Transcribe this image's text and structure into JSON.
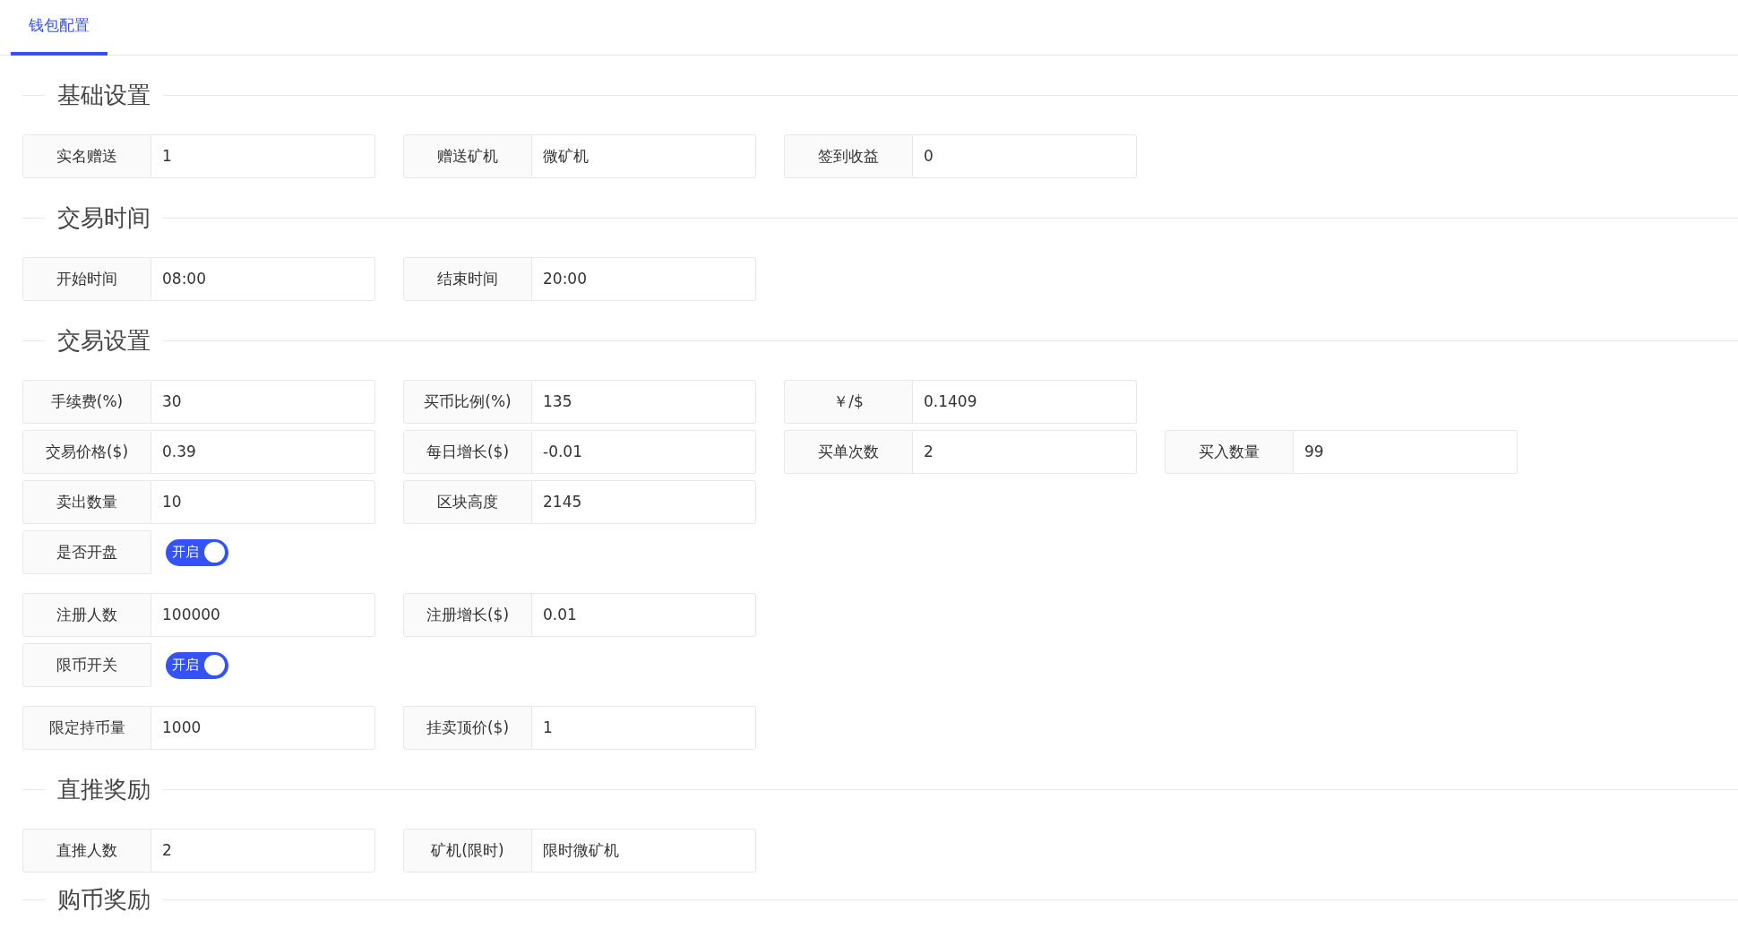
{
  "tabs": [
    {
      "label": "钱包配置",
      "selected": true
    }
  ],
  "sections": [
    {
      "title": "基础设置",
      "rows": [
        [
          {
            "kind": "input",
            "label": "实名赠送",
            "value": "1"
          },
          {
            "kind": "input",
            "label": "赠送矿机",
            "value": "微矿机"
          },
          {
            "kind": "input",
            "label": "签到收益",
            "value": "0"
          }
        ]
      ]
    },
    {
      "title": "交易时间",
      "rows": [
        [
          {
            "kind": "input",
            "label": "开始时间",
            "value": "08:00"
          },
          {
            "kind": "input",
            "label": "结束时间",
            "value": "20:00"
          }
        ]
      ]
    },
    {
      "title": "交易设置",
      "rows": [
        [
          {
            "kind": "input",
            "label": "手续费(%)",
            "value": "30"
          },
          {
            "kind": "input",
            "label": "买币比例(%)",
            "value": "135"
          },
          {
            "kind": "input",
            "label": "￥/$",
            "value": "0.1409"
          }
        ],
        [
          {
            "kind": "input",
            "label": "交易价格($)",
            "value": "0.39"
          },
          {
            "kind": "input",
            "label": "每日增长($)",
            "value": "-0.01"
          },
          {
            "kind": "input",
            "label": "买单次数",
            "value": "2"
          },
          {
            "kind": "input",
            "label": "买入数量",
            "value": "99"
          }
        ],
        [
          {
            "kind": "input",
            "label": "卖出数量",
            "value": "10"
          },
          {
            "kind": "input",
            "label": "区块高度",
            "value": "2145"
          }
        ],
        [
          {
            "kind": "switch",
            "label": "是否开盘",
            "on": true,
            "text": "开启"
          }
        ],
        [
          {
            "kind": "input",
            "label": "注册人数",
            "value": "100000"
          },
          {
            "kind": "input",
            "label": "注册增长($)",
            "value": "0.01"
          }
        ],
        [
          {
            "kind": "switch",
            "label": "限币开关",
            "on": true,
            "text": "开启"
          }
        ],
        [
          {
            "kind": "input",
            "label": "限定持币量",
            "value": "1000"
          },
          {
            "kind": "input",
            "label": "挂卖顶价($)",
            "value": "1"
          }
        ]
      ]
    },
    {
      "title": "直推奖励",
      "rows": [
        [
          {
            "kind": "input",
            "label": "直推人数",
            "value": "2"
          },
          {
            "kind": "input",
            "label": "矿机(限时)",
            "value": "限时微矿机"
          }
        ]
      ]
    },
    {
      "title": "购币奖励"
    }
  ]
}
